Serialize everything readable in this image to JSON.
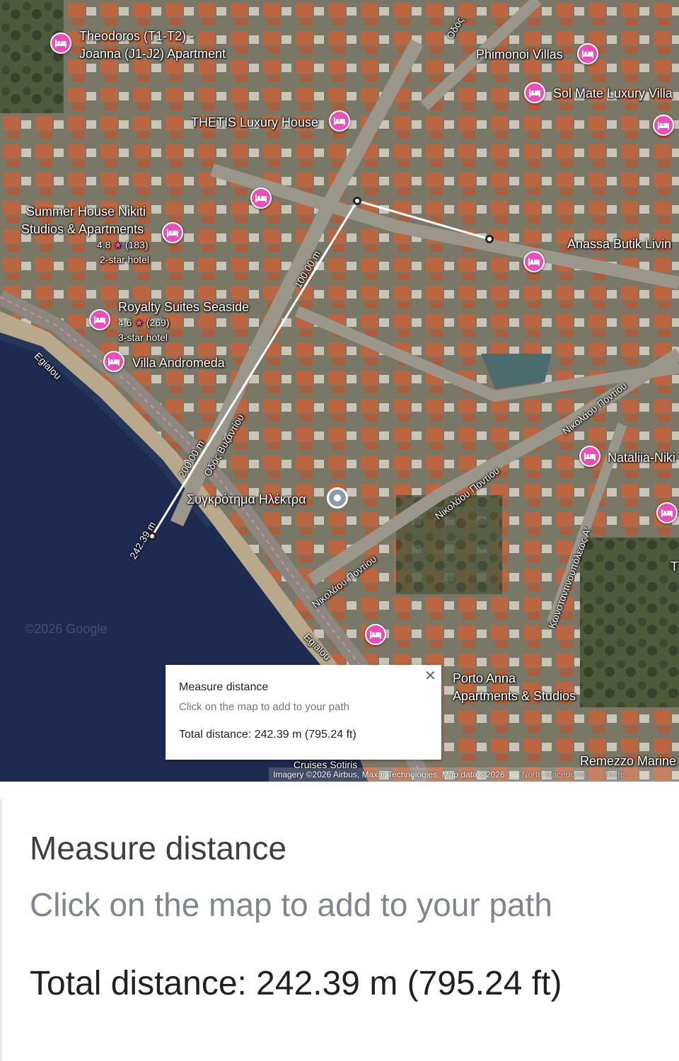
{
  "map": {
    "places": [
      {
        "name": "Theodoros (T1-T2) -"
      },
      {
        "name": "Joanna (J1-J2) Apartment"
      },
      {
        "name": "Phimonoi Villas"
      },
      {
        "name": "Sol Mate Luxury Villa"
      },
      {
        "name": "THETIS Luxury House"
      },
      {
        "name": "Summer House Nikiti"
      },
      {
        "name": "Studios & Apartments"
      },
      {
        "name": "Anassa Butik Livin"
      },
      {
        "name": "Royalty Suites Seaside"
      },
      {
        "name": "Villa Andromeda"
      },
      {
        "name": "Nataliia-Niki"
      },
      {
        "name": "Porto Anna"
      },
      {
        "name": "Apartments & Studios"
      },
      {
        "name": "Remezzo Marine"
      },
      {
        "name": "Cruises Sotiris"
      },
      {
        "name": "Συγκρότημα Ηλέκτρα"
      }
    ],
    "ratings": {
      "summer_house": {
        "rating": "4.8",
        "reviews": "(183)",
        "class": "2-star hotel"
      },
      "royalty_suites": {
        "rating": "4.6",
        "reviews": "(269)",
        "class": "3-star hotel"
      }
    },
    "streets": {
      "egialou_1": "Egialou",
      "egialou_2": "Egialou",
      "odos_vyzantiou": "Οδός Βυζαντίου",
      "odos_top": "Οδός",
      "nikolaou_1": "Νικολάου Ποντίου",
      "nikolaou_2": "Νικολάου Ποντίου",
      "nikolaou_3": "Νικολάου Ποντίου",
      "konstantinoupoleos": "Κωνσταντινουπόλεως Α'",
      "edge_letter": "T"
    },
    "measure_labels": {
      "m100": "100.00 m",
      "m200": "200.00 m",
      "m242": "242.39 m"
    },
    "watermark": "©2026 Google",
    "attribution": {
      "imagery": "Imagery ©2026 Airbus, Maxar Technologies, Map data ©2026",
      "region": "North Macedonia",
      "terms": "Terms"
    }
  },
  "popup": {
    "title": "Measure distance",
    "subtitle": "Click on the map to add to your path",
    "total": "Total distance: 242.39 m (795.24 ft)",
    "close_icon": "close-icon"
  },
  "zoomed": {
    "title": "Measure distance",
    "subtitle": "Click on the map to add to your path",
    "total": "Total distance: 242.39 m (795.24 ft)"
  },
  "colors": {
    "hotel_pin": "#ea4fb8",
    "sea": "#1c2b4f",
    "roof": "#c8643a"
  }
}
